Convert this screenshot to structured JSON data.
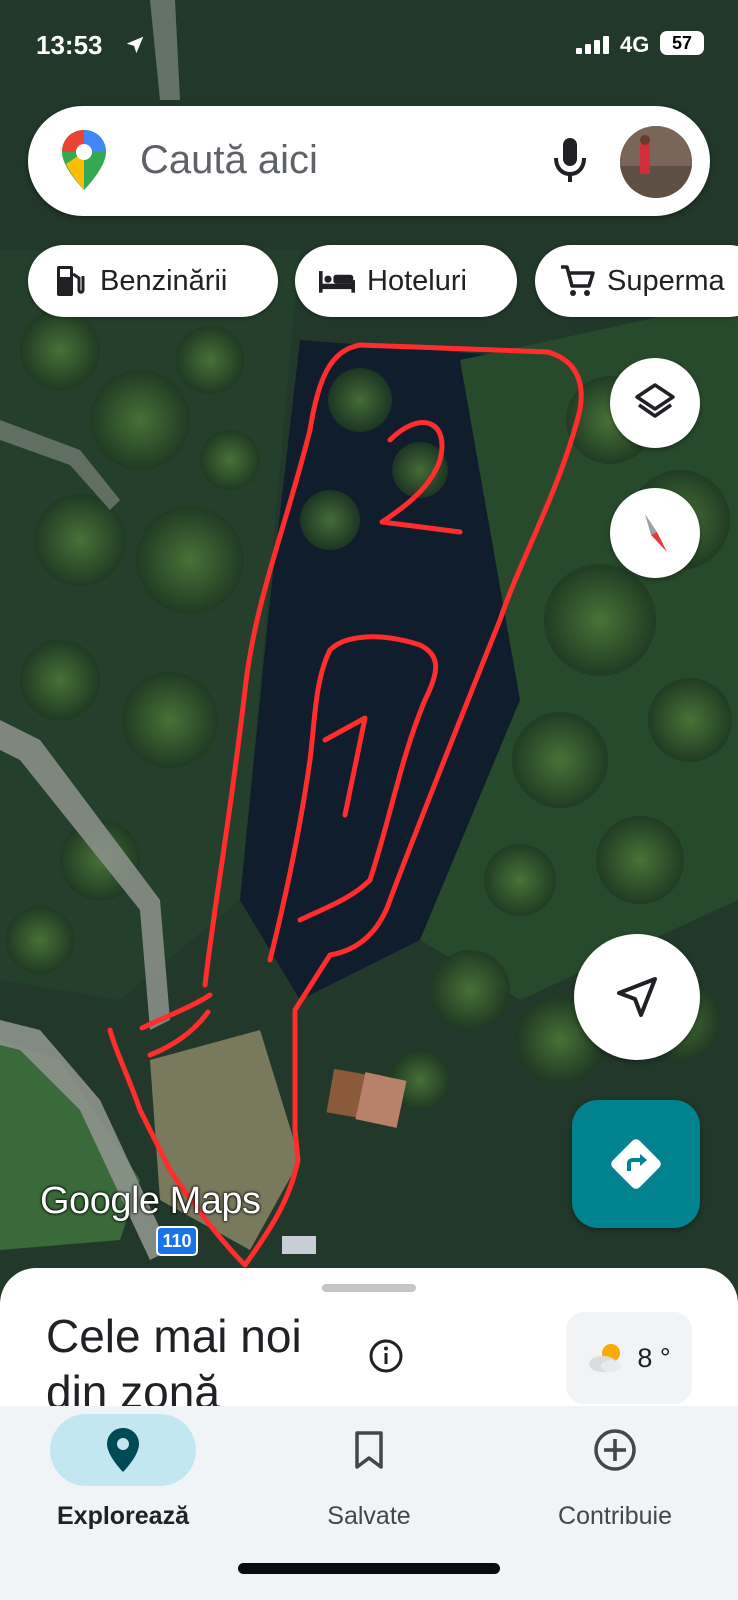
{
  "status_bar": {
    "time": "13:53",
    "network": "4G",
    "battery": "57"
  },
  "search": {
    "placeholder": "Caută aici"
  },
  "chips": [
    {
      "label": "Benzinării",
      "icon": "gas-station-icon"
    },
    {
      "label": "Hoteluri",
      "icon": "bed-icon"
    },
    {
      "label": "Superma",
      "icon": "cart-icon"
    }
  ],
  "map": {
    "attribution": "Google Maps",
    "road_shield": "110",
    "annotations": [
      "1",
      "2"
    ],
    "annotation_color": "#ff2d2d"
  },
  "map_controls": {
    "layers": "layers-icon",
    "compass": "compass-icon",
    "my_location": "navigation-arrow-icon",
    "directions": "directions-icon"
  },
  "sheet": {
    "title": "Cele mai noi din zonă",
    "weather_temp": "8 °"
  },
  "nav": {
    "items": [
      {
        "label": "Explorează",
        "icon": "explore-pin-icon",
        "active": true
      },
      {
        "label": "Salvate",
        "icon": "bookmark-icon",
        "active": false
      },
      {
        "label": "Contribuie",
        "icon": "add-circle-icon",
        "active": false
      }
    ]
  },
  "colors": {
    "accent": "#00838f",
    "active_pill": "#c2e7f0",
    "scribble": "#ff2d2d"
  }
}
